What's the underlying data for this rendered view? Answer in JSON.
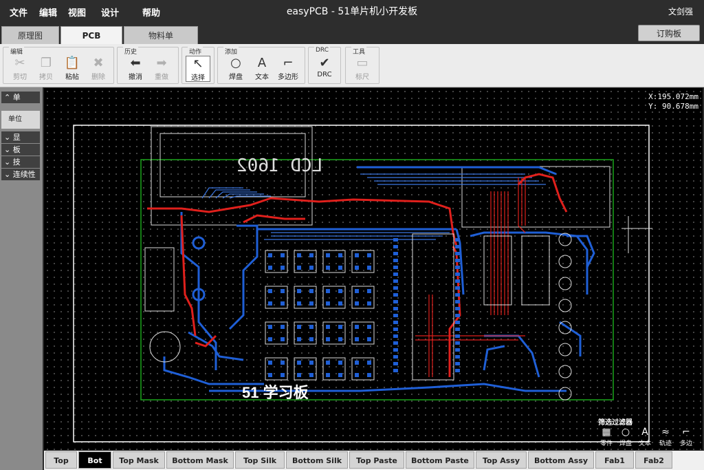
{
  "menubar": {
    "items": [
      "文件",
      "编辑",
      "视图",
      "设计",
      "帮助"
    ],
    "title": "easyPCB - 51单片机小开发板",
    "user": "文剑强"
  },
  "tabs": [
    "原理图",
    "PCB",
    "物料单"
  ],
  "order_button": "订购板",
  "toolbar": {
    "groups": {
      "edit": {
        "title": "编辑",
        "buttons": [
          "剪切",
          "拷贝",
          "粘帖",
          "删除"
        ]
      },
      "history": {
        "title": "历史",
        "buttons": [
          "撤消",
          "重做"
        ]
      },
      "action": {
        "title": "动作",
        "buttons": [
          "选择"
        ]
      },
      "add": {
        "title": "添加",
        "buttons": [
          "焊盘",
          "文本",
          "多边形"
        ]
      },
      "drc": {
        "title": "DRC",
        "buttons": [
          "DRC"
        ]
      },
      "tools": {
        "title": "工具",
        "buttons": [
          "标尺"
        ]
      }
    }
  },
  "leftpanel": {
    "sections": [
      "单",
      "显",
      "板",
      "技",
      "连续性"
    ],
    "unit_label": "单位"
  },
  "canvas": {
    "coord_x": "X:195.072mm",
    "coord_y": "Y: 90.678mm",
    "silk_text": "51 学习板",
    "lcd_text": "LCD 1602",
    "colors": {
      "top": "#e0201c",
      "bottom": "#1f5fd6",
      "outline": "#1aa51a",
      "silk": "#ffffff"
    }
  },
  "layers": [
    "Top",
    "Bot",
    "Top Mask",
    "Bottom Mask",
    "Top Silk",
    "Bottom Silk",
    "Top Paste",
    "Bottom Paste",
    "Top Assy",
    "Bottom Assy",
    "Fab1",
    "Fab2"
  ],
  "filter": {
    "title": "筛选过滤器",
    "items": [
      "零件",
      "焊盘",
      "文本",
      "轨迹",
      "多边"
    ]
  }
}
